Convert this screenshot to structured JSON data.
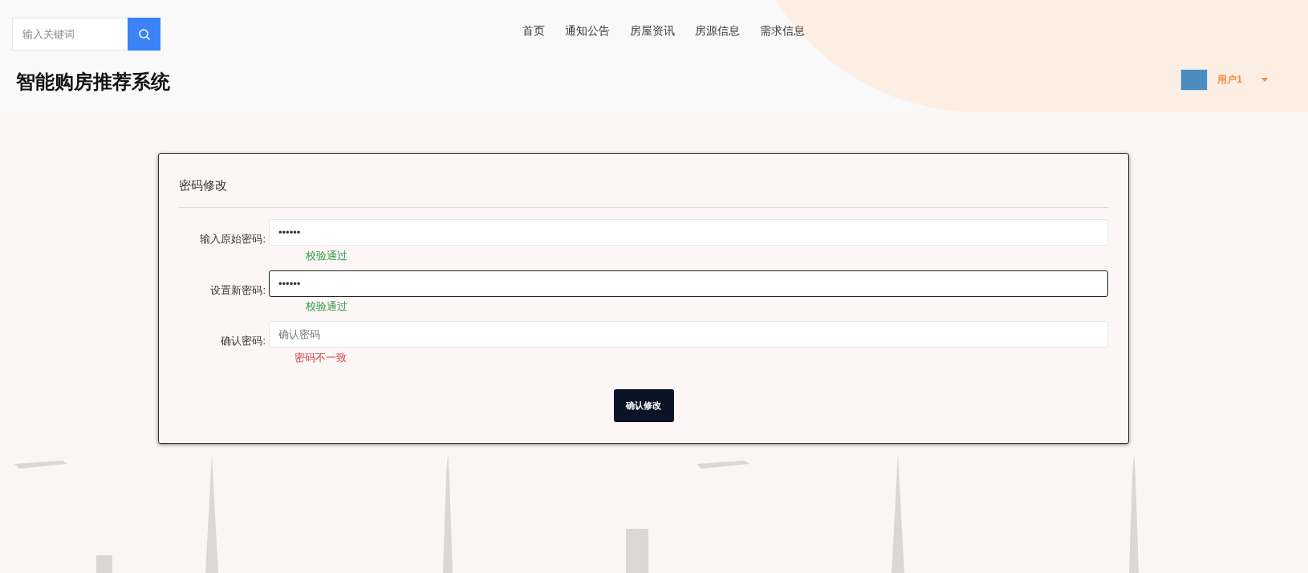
{
  "header": {
    "search": {
      "placeholder": "输入关键词"
    },
    "nav": [
      {
        "label": "首页"
      },
      {
        "label": "通知公告"
      },
      {
        "label": "房屋资讯"
      },
      {
        "label": "房源信息"
      },
      {
        "label": "需求信息"
      }
    ],
    "site_title": "智能购房推荐系统",
    "user": {
      "name": "用户1"
    }
  },
  "form": {
    "title": "密码修改",
    "fields": [
      {
        "label": "输入原始密码:",
        "value": "••••••",
        "focused": false,
        "message": {
          "text": "校验通过",
          "kind": "ok"
        }
      },
      {
        "label": "设置新密码:",
        "value": "••••••",
        "focused": true,
        "message": {
          "text": "校验通过",
          "kind": "ok"
        }
      },
      {
        "label": "确认密码:",
        "placeholder": "确认密码",
        "focused": false,
        "message": {
          "text": "密码不一致",
          "kind": "error"
        }
      }
    ],
    "submit": "确认修改"
  }
}
